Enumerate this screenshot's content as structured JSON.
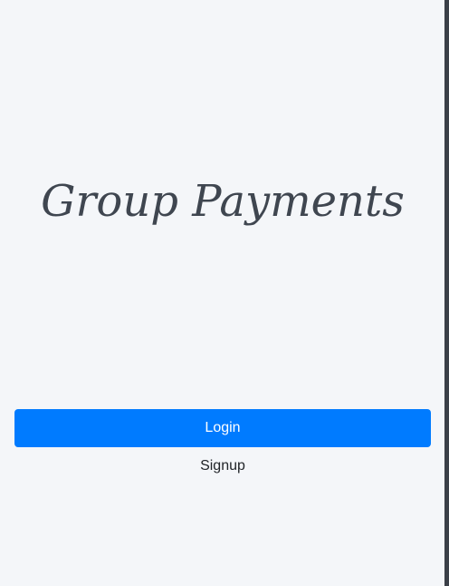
{
  "app": {
    "title": "Group Payments"
  },
  "actions": {
    "login_label": "Login",
    "signup_label": "Signup"
  },
  "colors": {
    "background": "#f4f6f9",
    "primary": "#007bff",
    "title_text": "#3f4650",
    "link_text": "#212529"
  }
}
